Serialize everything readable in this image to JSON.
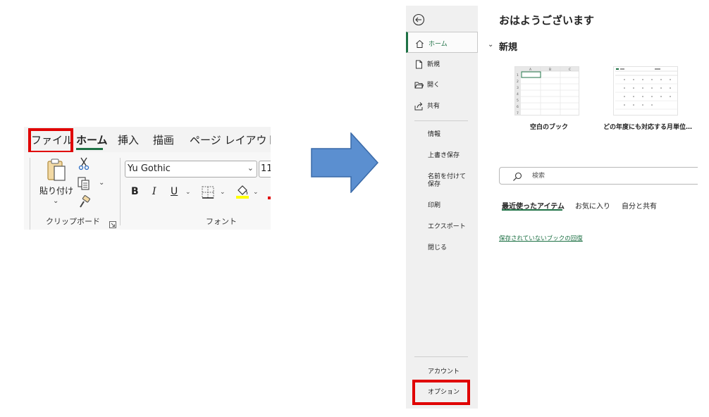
{
  "ribbon": {
    "tabs": {
      "file": "ファイル",
      "home": "ホーム",
      "insert": "挿入",
      "draw": "描画",
      "page_layout": "ページ レイアウト"
    },
    "clipboard": {
      "paste_label": "貼り付け",
      "group_label": "クリップボード"
    },
    "font": {
      "font_name": "Yu Gothic",
      "font_size": "11",
      "bold": "B",
      "italic": "I",
      "underline": "U",
      "group_label": "フォント"
    }
  },
  "backstage": {
    "nav": {
      "home": "ホーム",
      "new": "新規",
      "open": "開く",
      "share": "共有",
      "info": "情報",
      "save": "上書き保存",
      "save_as": "名前を付けて保存",
      "print": "印刷",
      "export": "エクスポート",
      "close": "閉じる",
      "account": "アカウント",
      "options": "オプション"
    },
    "main": {
      "greeting": "おはようございます",
      "new_heading": "新規",
      "templates": [
        {
          "label": "空白のブック"
        },
        {
          "label": "どの年度にも対応する月単位…"
        }
      ],
      "search_placeholder": "検索",
      "file_tabs": {
        "recent": "最近使ったアイテム",
        "favorites": "お気に入り",
        "shared": "自分と共有"
      },
      "recover_link": "保存されていないブックの回復"
    }
  },
  "colors": {
    "accent_green": "#1e7145",
    "highlight_red": "#e00000",
    "arrow_fill": "#5b8fd0",
    "arrow_stroke": "#3a6aa8"
  }
}
